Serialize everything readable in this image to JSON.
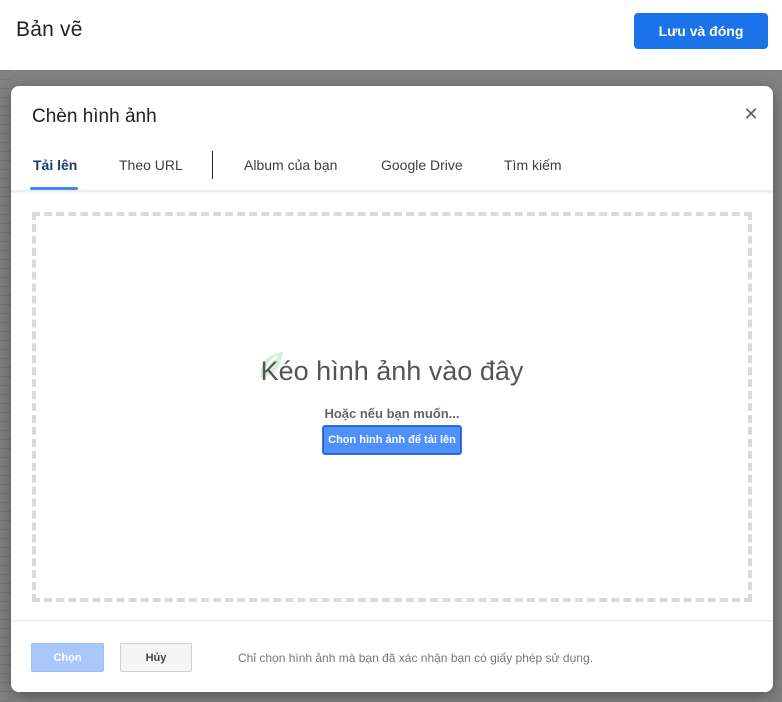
{
  "app": {
    "title": "Bản vẽ",
    "save_close_label": "Lưu và đóng"
  },
  "dialog": {
    "title": "Chèn hình ảnh",
    "close_icon": "close-icon",
    "tabs": [
      {
        "label": "Tải lên",
        "active": true
      },
      {
        "label": "Theo URL",
        "active": false
      },
      {
        "label": "Album của bạn",
        "active": false
      },
      {
        "label": "Google Drive",
        "active": false
      },
      {
        "label": "Tìm kiếm",
        "active": false
      }
    ],
    "drop_zone": {
      "title": "Kéo hình ảnh vào đây",
      "subtitle": "Hoặc nếu bạn muốn...",
      "choose_label": "Chọn hình ảnh để tải lên"
    },
    "footer": {
      "select_label": "Chọn",
      "cancel_label": "Hủy",
      "note": "Chỉ chọn hình ảnh mà bạn đã xác nhận bạn có giấy phép sử dụng."
    }
  },
  "colors": {
    "accent": "#1a73e8",
    "tab_indicator": "#4285f4",
    "choose_button": "#4d90fe",
    "select_disabled": "#a8c7fa",
    "backdrop": "#828282"
  }
}
